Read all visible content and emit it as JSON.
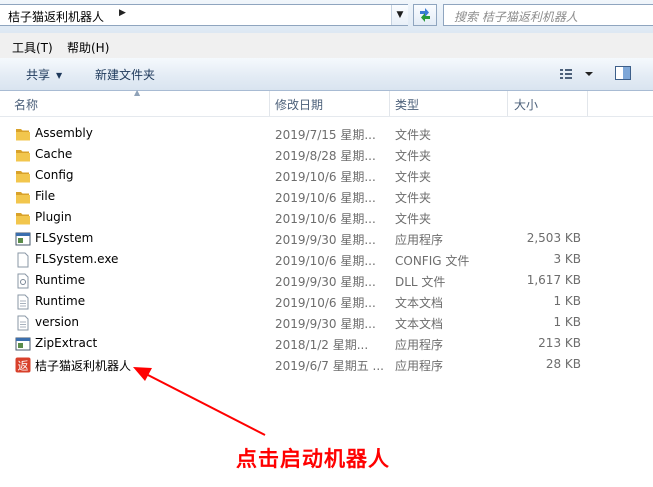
{
  "address_bar": {
    "breadcrumb": "桔子猫返利机器人",
    "search_placeholder": "搜索 桔子猫返利机器人"
  },
  "menu": {
    "tools": "工具(T)",
    "help": "帮助(H)"
  },
  "toolbar": {
    "share": "共享",
    "new_folder": "新建文件夹"
  },
  "columns": {
    "name": "名称",
    "date": "修改日期",
    "type": "类型",
    "size": "大小"
  },
  "files": [
    {
      "name": "Assembly",
      "date": "2019/7/15 星期...",
      "type": "文件夹",
      "size": "",
      "icon": "folder-icon"
    },
    {
      "name": "Cache",
      "date": "2019/8/28 星期...",
      "type": "文件夹",
      "size": "",
      "icon": "folder-icon"
    },
    {
      "name": "Config",
      "date": "2019/10/6 星期...",
      "type": "文件夹",
      "size": "",
      "icon": "folder-icon"
    },
    {
      "name": "File",
      "date": "2019/10/6 星期...",
      "type": "文件夹",
      "size": "",
      "icon": "folder-icon"
    },
    {
      "name": "Plugin",
      "date": "2019/10/6 星期...",
      "type": "文件夹",
      "size": "",
      "icon": "folder-icon"
    },
    {
      "name": "FLSystem",
      "date": "2019/9/30 星期...",
      "type": "应用程序",
      "size": "2,503 KB",
      "icon": "application-icon"
    },
    {
      "name": "FLSystem.exe",
      "date": "2019/10/6 星期...",
      "type": "CONFIG 文件",
      "size": "3 KB",
      "icon": "document-icon"
    },
    {
      "name": "Runtime",
      "date": "2019/9/30 星期...",
      "type": "DLL 文件",
      "size": "1,617 KB",
      "icon": "dll-icon"
    },
    {
      "name": "Runtime",
      "date": "2019/10/6 星期...",
      "type": "文本文档",
      "size": "1 KB",
      "icon": "text-document-icon"
    },
    {
      "name": "version",
      "date": "2019/9/30 星期...",
      "type": "文本文档",
      "size": "1 KB",
      "icon": "text-document-icon"
    },
    {
      "name": "ZipExtract",
      "date": "2018/1/2 星期...",
      "type": "应用程序",
      "size": "213 KB",
      "icon": "application-icon"
    },
    {
      "name": "桔子猫返利机器人",
      "date": "2019/6/7 星期五 ...",
      "type": "应用程序",
      "size": "28 KB",
      "icon": "robot-app-icon"
    }
  ],
  "annotation": {
    "text": "点击启动机器人",
    "color": "#ff0000"
  },
  "colors": {
    "folder": "#e8b33a",
    "header_text": "#4c607a",
    "robot_icon": "#d8402b"
  }
}
